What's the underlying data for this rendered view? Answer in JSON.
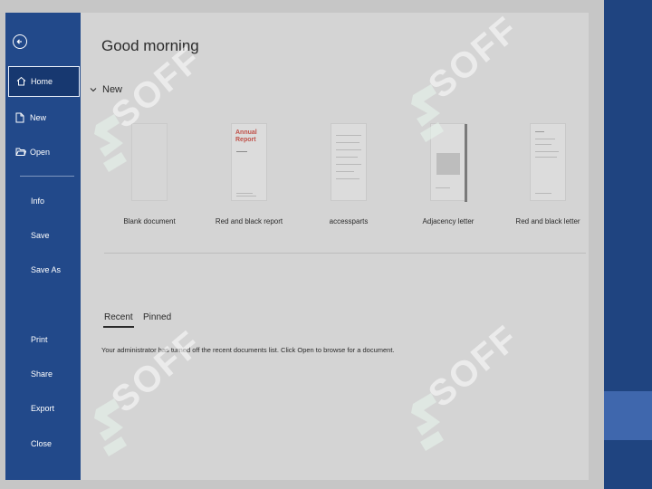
{
  "greeting": "Good morning",
  "new_section": {
    "label": "New"
  },
  "templates": [
    {
      "label": "Blank document"
    },
    {
      "label": "Red and black report",
      "thumb_text": "Annual Report"
    },
    {
      "label": "accessparts"
    },
    {
      "label": "Adjacency letter"
    },
    {
      "label": "Red and black letter"
    }
  ],
  "sidebar": {
    "items": [
      {
        "label": "Home",
        "icon": "home-icon",
        "selected": true
      },
      {
        "label": "New",
        "icon": "new-document-icon"
      },
      {
        "label": "Open",
        "icon": "open-folder-icon"
      },
      {
        "label": "Info"
      },
      {
        "label": "Save"
      },
      {
        "label": "Save As"
      },
      {
        "label": "Print"
      },
      {
        "label": "Share"
      },
      {
        "label": "Export"
      },
      {
        "label": "Close"
      }
    ]
  },
  "tabs": [
    {
      "label": "Recent",
      "active": true
    },
    {
      "label": "Pinned"
    }
  ],
  "recent_notice": "Your administrator has turned off the recent documents list. Click Open to browse for a document.",
  "watermark": "SOFF",
  "colors": {
    "sidebar": "#22498a",
    "sidebar_selected": "#173870",
    "accent_red": "#c0524a",
    "watermark": "#e8f7ee"
  }
}
